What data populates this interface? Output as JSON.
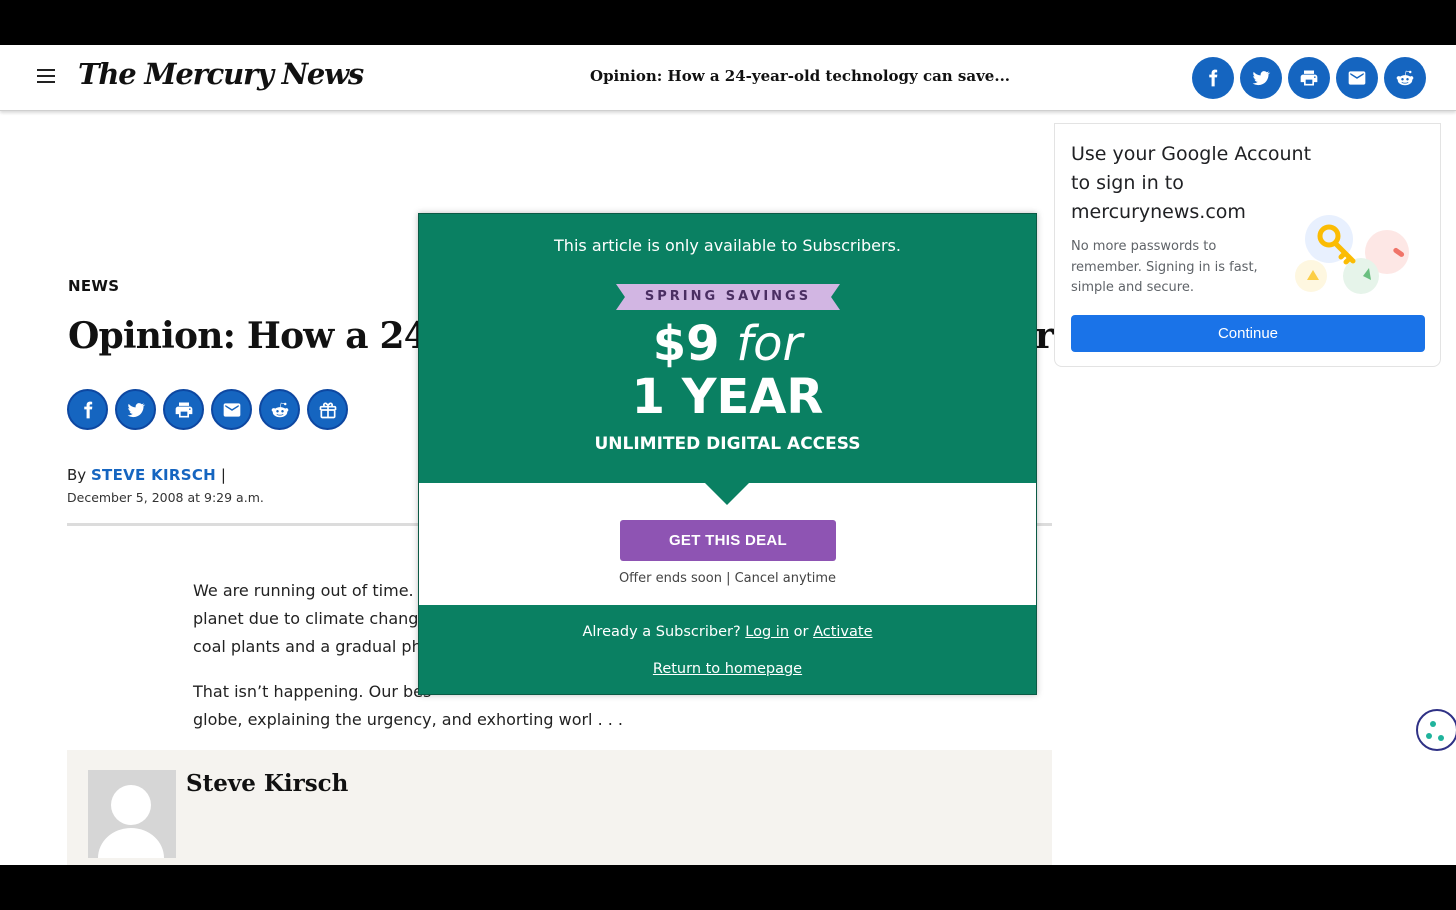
{
  "header": {
    "logo": "The Mercury News",
    "article_title": "Opinion: How a 24-year-old technology can save..."
  },
  "article": {
    "section": "NEWS",
    "headline": "Opinion: How a 24-y",
    "headline_tail": "r",
    "byline_prefix": "By",
    "author": "STEVE KIRSCH",
    "byline_separator": "|",
    "date": "December 5, 2008 at 9:29 a.m.",
    "para1": "We are running out of time. S\nplanet due to climate change,\ncoal plants and a gradual pha",
    "para2_start": "That isn’t happening. Our bes",
    "para2_line2": "globe, explaining the urgency, and exhorting worl . . ."
  },
  "author_box": {
    "name": "Steve Kirsch"
  },
  "google_signin": {
    "title": "Use your Google Account to sign in to mercurynews.com",
    "description": "No more passwords to remember. Signing in is fast, simple and secure.",
    "button": "Continue"
  },
  "paywall": {
    "notice": "This article is only available to Subscribers.",
    "ribbon": "SPRING SAVINGS",
    "price": "$9",
    "price_for": "for",
    "duration": "1 YEAR",
    "access": "UNLIMITED DIGITAL ACCESS",
    "cta": "GET THIS DEAL",
    "offer_note": "Offer ends soon | Cancel anytime",
    "already": "Already a Subscriber?",
    "login": "Log in",
    "or": "or",
    "activate": "Activate",
    "return_home": "Return to homepage"
  },
  "colors": {
    "brand_blue": "#1565c0",
    "paywall_green": "#0a8062",
    "ribbon_lavender": "#d2b6e3",
    "cta_purple": "#8e54b3",
    "google_blue": "#1a73e8"
  },
  "icons": {
    "share": [
      "facebook-icon",
      "twitter-icon",
      "print-icon",
      "email-icon",
      "reddit-icon"
    ],
    "article_share_extra": "gift-icon"
  }
}
